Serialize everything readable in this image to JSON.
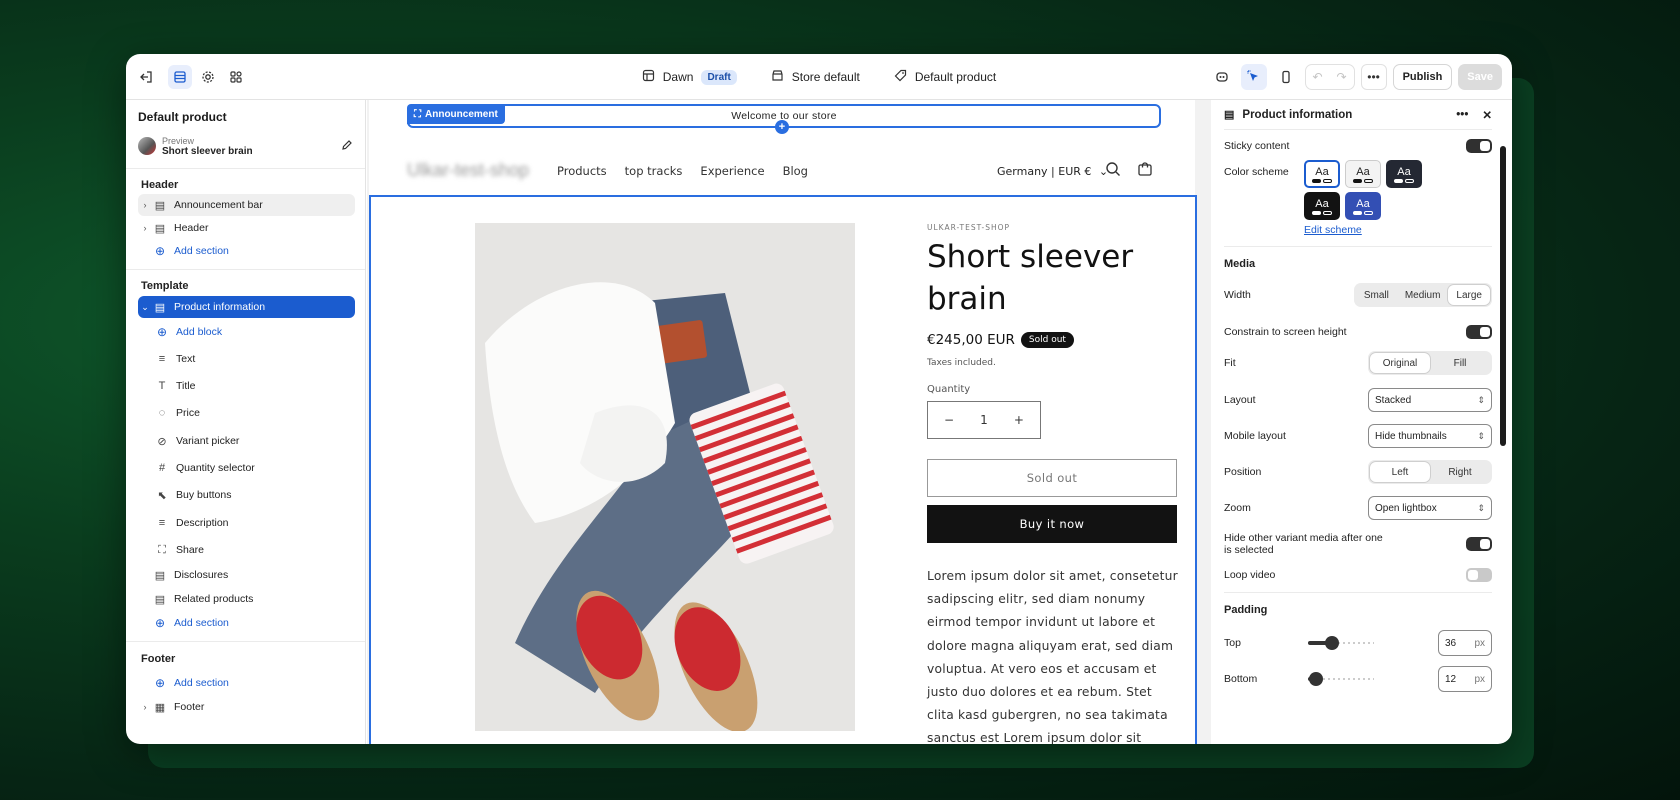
{
  "topbar": {
    "theme_name": "Dawn",
    "theme_status": "Draft",
    "store_label": "Store default",
    "template_label": "Default product",
    "publish_label": "Publish",
    "save_label": "Save"
  },
  "sidebar": {
    "title": "Default product",
    "preview_label": "Preview",
    "preview_product": "Short sleever brain",
    "header_group": "Header",
    "header_items": [
      {
        "label": "Announcement bar"
      },
      {
        "label": "Header"
      }
    ],
    "add_section": "Add section",
    "template_group": "Template",
    "selected_section": "Product information",
    "add_block": "Add block",
    "blocks": [
      {
        "label": "Text"
      },
      {
        "label": "Title"
      },
      {
        "label": "Price"
      },
      {
        "label": "Variant picker"
      },
      {
        "label": "Quantity selector"
      },
      {
        "label": "Buy buttons"
      },
      {
        "label": "Description"
      },
      {
        "label": "Share"
      }
    ],
    "template_sections": [
      {
        "label": "Disclosures"
      },
      {
        "label": "Related products"
      }
    ],
    "footer_group": "Footer",
    "footer_item": "Footer"
  },
  "store": {
    "announcement_tag": "Announcement",
    "announcement_text": "Welcome to our store",
    "logo_text": "Ulkar-test-shop",
    "nav": [
      "Products",
      "top tracks",
      "Experience",
      "Blog"
    ],
    "locale": "Germany | EUR €",
    "product": {
      "vendor": "ULKAR-TEST-SHOP",
      "title": "Short sleever brain",
      "price": "€245,00 EUR",
      "badge": "Sold out",
      "taxes": "Taxes included.",
      "quantity_label": "Quantity",
      "quantity_value": "1",
      "soldout_button": "Sold out",
      "buy_button": "Buy it now",
      "description": "Lorem ipsum dolor sit amet, consetetur sadipscing elitr, sed diam nonumy eirmod tempor invidunt ut labore et dolore magna aliquyam erat, sed diam voluptua. At vero eos et accusam et justo duo dolores et ea rebum. Stet clita kasd gubergren, no sea takimata sanctus est Lorem ipsum dolor sit"
    }
  },
  "panel": {
    "title": "Product information",
    "sticky_content": "Sticky content",
    "color_scheme": "Color scheme",
    "swatch_text": "Aa",
    "edit_scheme": "Edit scheme",
    "media_title": "Media",
    "width_label": "Width",
    "width_options": [
      "Small",
      "Medium",
      "Large"
    ],
    "constrain_label": "Constrain to screen height",
    "fit_label": "Fit",
    "fit_options": [
      "Original",
      "Fill"
    ],
    "layout_label": "Layout",
    "layout_value": "Stacked",
    "mobile_layout_label": "Mobile layout",
    "mobile_layout_value": "Hide thumbnails",
    "position_label": "Position",
    "position_options": [
      "Left",
      "Right"
    ],
    "zoom_label": "Zoom",
    "zoom_value": "Open lightbox",
    "hide_variant_label": "Hide other variant media after one is selected",
    "loop_video_label": "Loop video",
    "padding_title": "Padding",
    "top_label": "Top",
    "top_value": "36",
    "bottom_label": "Bottom",
    "bottom_value": "12",
    "unit": "px",
    "padding_max": 100
  },
  "colors": {
    "accent": "#1b5ccf",
    "selection_outline": "#2a6ee0",
    "background": "#0a3d1e"
  }
}
